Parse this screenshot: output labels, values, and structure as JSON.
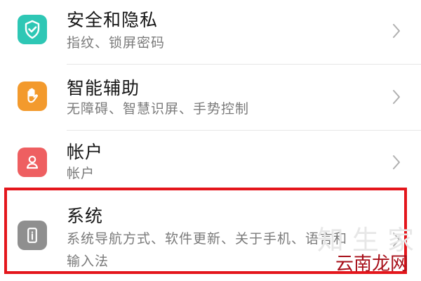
{
  "colors": {
    "security_icon_bg": "#2ec7b5",
    "assist_icon_bg": "#f39a2d",
    "account_icon_bg": "#ee5f61",
    "system_icon_bg": "#8f8f8f",
    "highlight_border": "#e4161c",
    "chevron": "#b0b0b0",
    "watermark_text": "#a70f19"
  },
  "settings": {
    "items": [
      {
        "title": "安全和隐私",
        "subtitle": "指纹、锁屏密码",
        "icon": "shield-check-icon"
      },
      {
        "title": "智能辅助",
        "subtitle": "无障碍、智慧识屏、手势控制",
        "icon": "hand-icon"
      },
      {
        "title": "帐户",
        "subtitle": "帐户",
        "icon": "user-icon"
      },
      {
        "title": "系统",
        "subtitle_line1": "系统导航方式、软件更新、关于手机、语言和",
        "subtitle_line2": "输入法",
        "icon": "info-phone-icon"
      }
    ]
  },
  "watermark": {
    "text": "云南龙网",
    "bg_text": "知 生 家"
  }
}
